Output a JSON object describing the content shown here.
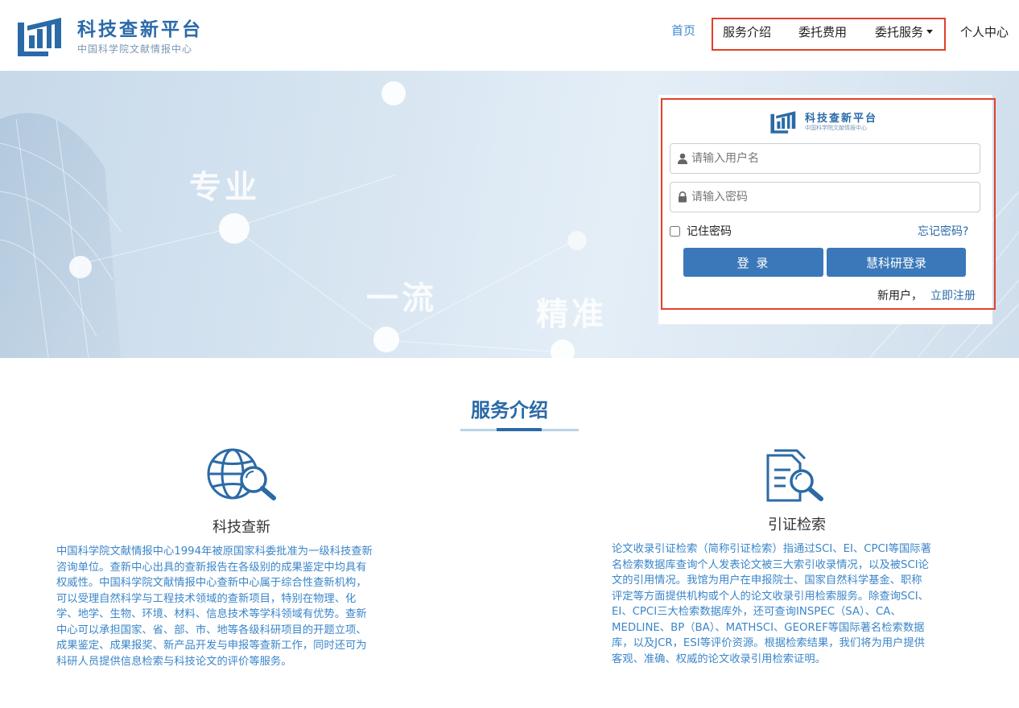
{
  "header": {
    "logo_title": "科技查新平台",
    "logo_subtitle": "中国科学院文献情报中心",
    "nav": {
      "home": "首页",
      "service_intro": "服务介绍",
      "fees": "委托费用",
      "services": "委托服务",
      "personal_center": "个人中心"
    }
  },
  "banner": {
    "words": [
      "专业",
      "一流",
      "精准"
    ]
  },
  "login": {
    "logo_title": "科技查新平台",
    "logo_subtitle": "中国科学院文献情报中心",
    "username_placeholder": "请输入用户名",
    "password_placeholder": "请输入密码",
    "remember_label": "记住密码",
    "forgot_label": "忘记密码?",
    "login_button": "登 录",
    "hky_button": "慧科研登录",
    "new_user_text": "新用户，",
    "register_link": "立即注册"
  },
  "services": {
    "title": "服务介绍",
    "cards": [
      {
        "title": "科技查新",
        "lines": [
          "中国科学院文献情报中心1994年被原国家科委批准为一级科技查新",
          "咨询单位。查新中心出具的查新报告在各级别的成果鉴定中均具有",
          "权威性。中国科学院文献情报中心查新中心属于综合性查新机构，",
          "可以受理自然科学与工程技术领域的查新项目，特别在物理、化",
          "学、地学、生物、环境、材料、信息技术等学科领域有优势。查新",
          "中心可以承担国家、省、部、市、地等各级科研项目的开题立项、",
          "成果鉴定、成果报奖、新产品开发与申报等查新工作，同时还可为",
          "科研人员提供信息检索与科技论文的评价等服务。"
        ]
      },
      {
        "title": "引证检索",
        "lines": [
          "论文收录引证检索（简称引证检索）指通过SCI、EI、CPCI等国际著",
          "名检索数据库查询个人发表论文被三大索引收录情况，以及被SCI论",
          "文的引用情况。我馆为用户在申报院士、国家自然科学基金、职称",
          "评定等方面提供机构或个人的论文收录引用检索服务。除查询SCI、",
          "EI、CPCI三大检索数据库外，还可查询INSPEC（SA）、CA、",
          "MEDLINE、BP（BA）、MATHSCI、GEOREF等国际著名检索数据",
          "库，以及JCR，ESI等评价资源。根据检索结果，我们将为用户提供",
          "客观、准确、权威的论文收录引用检索证明。"
        ]
      }
    ]
  },
  "colors": {
    "brand_blue": "#2a6aa8",
    "button_blue": "#3b78b9",
    "highlight_red": "#e2402c",
    "body_text_blue": "#3b86c9"
  }
}
